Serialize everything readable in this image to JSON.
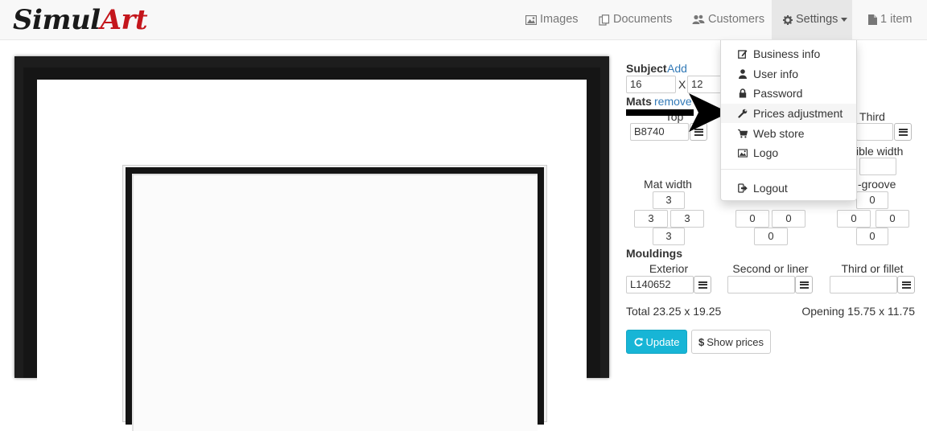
{
  "brand": {
    "part1": "Simul",
    "part2": "Art"
  },
  "nav": {
    "images": "Images",
    "documents": "Documents",
    "customers": "Customers",
    "settings": "Settings",
    "cart": "1 item"
  },
  "settings_menu": {
    "business_info": "Business info",
    "user_info": "User info",
    "password": "Password",
    "prices_adjustment": "Prices adjustment",
    "web_store": "Web store",
    "logo": "Logo",
    "logout": "Logout"
  },
  "subject": {
    "label": "Subject",
    "add_link": "Add",
    "width": "16",
    "x": "X",
    "height": "12"
  },
  "mats": {
    "label": "Mats",
    "remove_link": "remove",
    "top_label": "Top",
    "third_label": "Third",
    "top_code": "B8740",
    "third_code": "",
    "visible_width_label": "ible width",
    "visible_width_value": "",
    "mat_width_label": "Mat width",
    "vgroove_label": "-groove",
    "mat_width": {
      "top": "3",
      "left": "3",
      "right": "3",
      "bottom": "3"
    },
    "second": {
      "left": "0",
      "right": "0",
      "bottom": "0"
    },
    "third": {
      "top": "0",
      "left": "0",
      "right": "0",
      "bottom": "0"
    }
  },
  "mouldings": {
    "label": "Mouldings",
    "exterior_label": "Exterior",
    "second_label": "Second or liner",
    "third_label": "Third or fillet",
    "exterior_code": "L140652",
    "second_code": "",
    "third_code": ""
  },
  "totals": {
    "total": "Total 23.25 x 19.25",
    "opening": "Opening 15.75 x 11.75"
  },
  "buttons": {
    "update": "Update",
    "show_prices": "Show prices"
  },
  "colors": {
    "navbar_bg": "#f8f8f8",
    "link": "#337ab7",
    "brand_red": "#c4161c",
    "update_bg": "#17b5d6",
    "frame": "#1d1d1d"
  }
}
